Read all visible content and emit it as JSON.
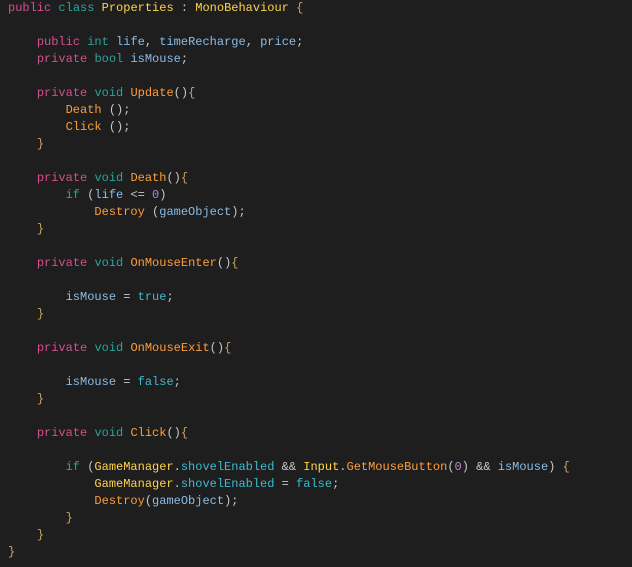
{
  "tokens": {
    "kw_public": "public",
    "kw_private": "private",
    "kw_class": "class",
    "kw_void": "void",
    "kw_int": "int",
    "kw_bool": "bool",
    "kw_if": "if",
    "kw_true": "true",
    "kw_false": "false",
    "cls_Properties": "Properties",
    "cls_MonoBehaviour": "MonoBehaviour",
    "cls_GameManager": "GameManager",
    "cls_Input": "Input",
    "id_life": "life",
    "id_timeRecharge": "timeRecharge",
    "id_price": "price",
    "id_isMouse": "isMouse",
    "id_gameObject": "gameObject",
    "id_shovelEnabled": "shovelEnabled",
    "fn_Update": "Update",
    "fn_Death": "Death",
    "fn_Click": "Click",
    "fn_OnMouseEnter": "OnMouseEnter",
    "fn_OnMouseExit": "OnMouseExit",
    "fn_Destroy": "Destroy",
    "fn_GetMouseButton": "GetMouseButton",
    "num_0a": "0",
    "num_0b": "0",
    "op_le": "<=",
    "op_assign": "=",
    "op_and": "&&",
    "p_colon": ":",
    "p_obrace": "{",
    "p_cbrace": "}",
    "p_oparen": "(",
    "p_cparen": ")",
    "p_semi": ";",
    "p_comma": ",",
    "p_dot": "."
  }
}
